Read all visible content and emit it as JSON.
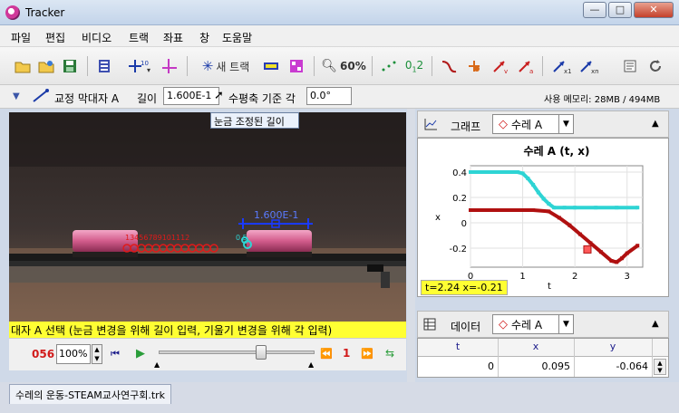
{
  "window": {
    "title": "Tracker",
    "min_label": "—",
    "max_label": "□",
    "close_label": "✕"
  },
  "menu": [
    "파일",
    "편집",
    "비디오",
    "트랙",
    "좌표",
    "창",
    "도움말"
  ],
  "toolbar": {
    "new_track_label": "새 트랙",
    "zoom_label": "60%"
  },
  "calibration": {
    "track_label": "교정 막대자 A",
    "length_label": "길이",
    "length_value": "1.600E-1",
    "angle_label": "수평축 기준 각",
    "angle_value": "0.0°",
    "memory_label": "사용 메모리: 28MB / 494MB",
    "tooltip": "눈금 조정된 길이"
  },
  "video": {
    "stick_label": "1.600E-1",
    "point_label_a": "0.5",
    "status_text": "대자 A 선택 (눈금 변경을 위해 길이 입력, 기울기 변경을 위해 각 입력)"
  },
  "player": {
    "frame": "056",
    "zoom": "100%",
    "step": "1"
  },
  "graph": {
    "tab_label": "그래프",
    "track": "수레 A",
    "readout": "t=2.24  x=-0.21",
    "colors": {
      "x": "#d11a1a",
      "v": "#2ed4d4"
    }
  },
  "chart_data": {
    "type": "line",
    "title": "수레 A (t, x)",
    "xlabel": "t",
    "ylabel": "x",
    "xlim": [
      0,
      3.3
    ],
    "ylim": [
      -0.35,
      0.45
    ],
    "x_ticks": [
      "0",
      "1",
      "2",
      "3"
    ],
    "y_ticks": [
      "0.4",
      "0.2",
      "0",
      "-0.2"
    ],
    "series": [
      {
        "color": "#2ed4d4",
        "x": [
          0.0,
          0.3,
          0.6,
          0.9,
          1.0,
          1.1,
          1.2,
          1.3,
          1.4,
          1.5,
          1.6,
          1.8,
          2.0,
          2.4,
          2.8,
          3.2
        ],
        "y": [
          0.4,
          0.4,
          0.4,
          0.4,
          0.39,
          0.35,
          0.3,
          0.24,
          0.19,
          0.15,
          0.12,
          0.12,
          0.12,
          0.12,
          0.12,
          0.12
        ]
      },
      {
        "color": "#b01010",
        "x": [
          0.0,
          0.4,
          0.8,
          1.2,
          1.5,
          1.7,
          1.9,
          2.1,
          2.3,
          2.5,
          2.7,
          2.8,
          2.9,
          3.0,
          3.2
        ],
        "y": [
          0.1,
          0.1,
          0.1,
          0.1,
          0.09,
          0.04,
          -0.02,
          -0.09,
          -0.16,
          -0.23,
          -0.3,
          -0.31,
          -0.28,
          -0.24,
          -0.18
        ]
      }
    ]
  },
  "data": {
    "tab_label": "데이터",
    "track": "수레 A",
    "columns": [
      "t",
      "x",
      "y"
    ],
    "row": [
      "0",
      "0.095",
      "-0.064"
    ]
  },
  "file_tab": "수레의 운동-STEAM교사연구회.trk"
}
